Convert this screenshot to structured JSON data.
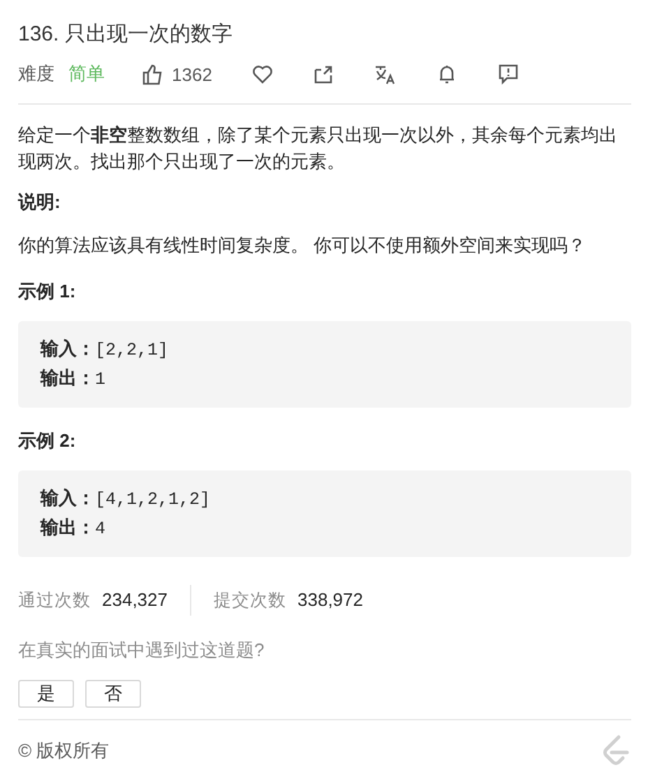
{
  "title": "136. 只出现一次的数字",
  "meta": {
    "difficulty_label": "难度",
    "difficulty": "简单",
    "likes": "1362"
  },
  "description": "给定一个**非空**整数数组，除了某个元素只出现一次以外，其余每个元素均出现两次。找出那个只出现了一次的元素。",
  "note_heading": "说明:",
  "note": "你的算法应该具有线性时间复杂度。 你可以不使用额外空间来实现吗？",
  "examples": [
    {
      "heading": "示例 1:",
      "lines": [
        {
          "label": "输入：",
          "value": "[2,2,1]"
        },
        {
          "label": "输出：",
          "value": "1"
        }
      ]
    },
    {
      "heading": "示例 2:",
      "lines": [
        {
          "label": "输入：",
          "value": "[4,1,2,1,2]"
        },
        {
          "label": "输出：",
          "value": "4"
        }
      ]
    }
  ],
  "stats": [
    {
      "label": "通过次数",
      "value": "234,327"
    },
    {
      "label": "提交次数",
      "value": "338,972"
    }
  ],
  "question": "在真实的面试中遇到过这道题?",
  "answers": [
    "是",
    "否"
  ],
  "footer": "© 版权所有"
}
